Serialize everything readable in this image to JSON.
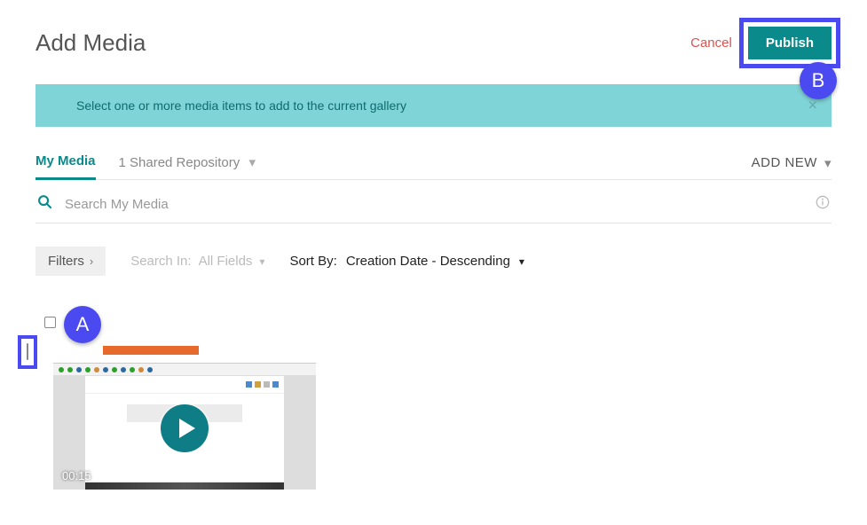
{
  "header": {
    "title": "Add Media",
    "cancel": "Cancel",
    "publish": "Publish"
  },
  "info_bar": {
    "text": "Select one or more media items to add to the current gallery",
    "close": "×"
  },
  "tabs": {
    "active": "My Media",
    "shared": "1 Shared Repository",
    "add_new": "ADD NEW"
  },
  "search": {
    "placeholder": "Search My Media"
  },
  "filters": {
    "button": "Filters",
    "search_in_label": "Search In:",
    "search_in_value": "All Fields",
    "sort_label": "Sort By:",
    "sort_value": "Creation Date - Descending"
  },
  "media": [
    {
      "duration": "00:15"
    }
  ],
  "annotations": {
    "a": "A",
    "b": "B"
  }
}
